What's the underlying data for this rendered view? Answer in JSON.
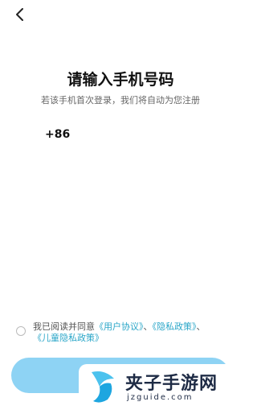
{
  "header": {
    "back_icon": "chevron-left-icon"
  },
  "main": {
    "title": "请输入手机号码",
    "subtitle": "若该手机首次登录，我们将自动为您注册",
    "country_code": "+86",
    "phone_value": ""
  },
  "agreement": {
    "prefix": "我已阅读并同意",
    "user_agreement": "《用户协议》",
    "sep1": "、",
    "privacy_policy": "《隐私政策》",
    "sep2": "、",
    "child_privacy": "《儿童隐私政策》"
  },
  "login_button": {
    "label": ""
  },
  "watermark": {
    "title": "夹子手游网",
    "url": "jzguide.com"
  },
  "colors": {
    "accent": "#8ed3f4",
    "link": "#2aa6c8",
    "watermark_logo": "#1ea6e0"
  }
}
